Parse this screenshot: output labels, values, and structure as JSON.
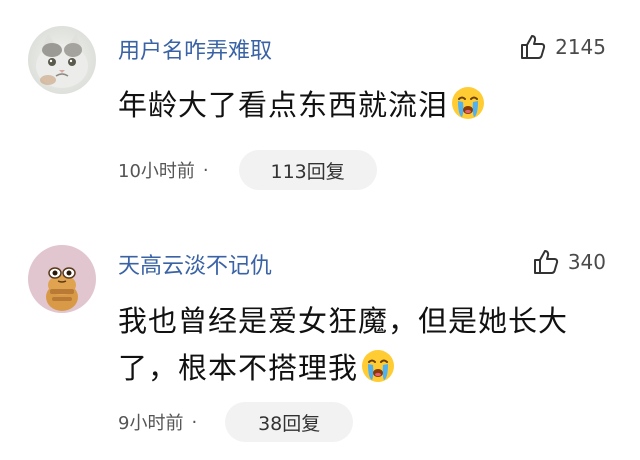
{
  "comments": [
    {
      "username": "用户名咋弄难取",
      "like_count": "2145",
      "text": "年龄大了看点东西就流泪",
      "emoji": "crying-face-icon",
      "time": "10小时前",
      "separator": "·",
      "reply_label": "113回复",
      "avatar": "cat-avatar"
    },
    {
      "username": "天高云淡不记仇",
      "like_count": "340",
      "text_line1": "我也曾经是爱女狂魔，但是她长大",
      "text_line2": "了，根本不搭理我",
      "emoji": "crying-face-icon",
      "time": "9小时前",
      "separator": "·",
      "reply_label": "38回复",
      "avatar": "cartoon-avatar"
    }
  ],
  "colors": {
    "username": "#3a63a6",
    "text": "#111111",
    "meta": "#555555",
    "pill_bg": "#f2f2f2"
  }
}
